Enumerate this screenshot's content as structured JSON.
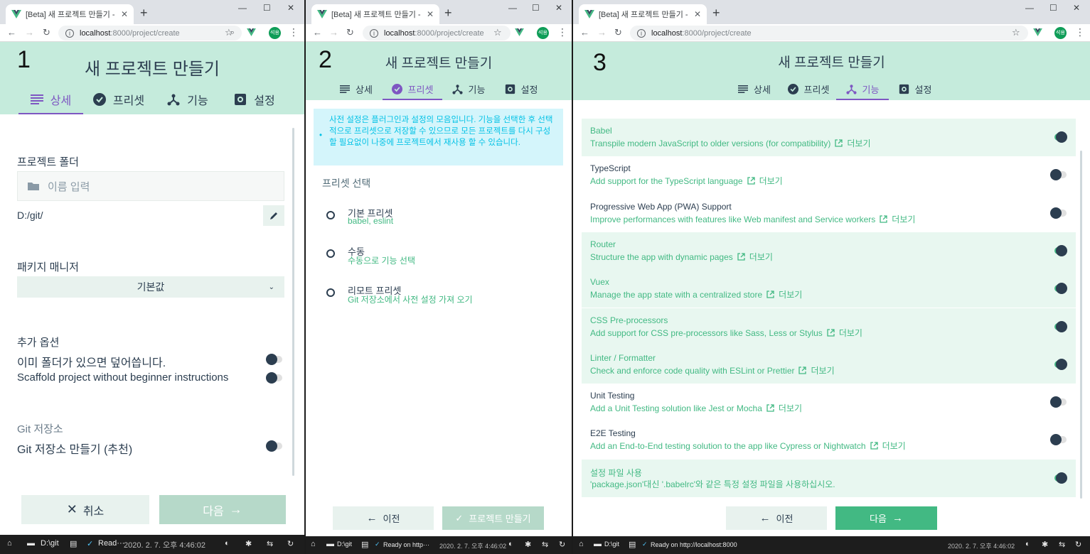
{
  "colors": {
    "accent": "#42b983",
    "purple": "#7e57c2",
    "header_bg": "#c5ebdc",
    "text": "#2c3e50",
    "info_blue": "#03c2e6"
  },
  "browser": {
    "tab_title": "[Beta] 새 프로젝트 만들기 - Vue",
    "url_prefix": "localhost",
    "url_rest": ":8000/project/create",
    "avatar": "석용"
  },
  "page": {
    "title": "새 프로젝트 만들기",
    "tabs": [
      {
        "label": "상세",
        "icon": "list-icon"
      },
      {
        "label": "프리셋",
        "icon": "check-circle-icon"
      },
      {
        "label": "기능",
        "icon": "fork-icon"
      },
      {
        "label": "설정",
        "icon": "gear-icon"
      }
    ]
  },
  "panel1": {
    "step": "1",
    "folder_label": "프로젝트 폴더",
    "folder_placeholder": "이름 입력",
    "path": "D:/git/",
    "pm_label": "패키지 매니저",
    "pm_value": "기본값",
    "options_label": "추가 옵션",
    "opt_overwrite": "이미 폴더가 있으면 덮어씁니다.",
    "opt_scaffold": "Scaffold project without beginner instructions",
    "git_label": "Git 저장소",
    "git_init": "Git 저장소 만들기 (추천)",
    "cancel": "취소",
    "next": "다음"
  },
  "panel2": {
    "step": "2",
    "info": "사전 설정은 플러그인과 설정의 모음입니다. 기능을 선택한 후 선택적으로 프리셋으로 저장할 수 있으므로 모든 프로젝트를 다시 구성 할 필요없이 나중에 프로젝트에서 재사용 할 수 있습니다.",
    "select_label": "프리셋 선택",
    "presets": [
      {
        "name": "기본 프리셋",
        "desc": "babel, eslint"
      },
      {
        "name": "수동",
        "desc": "수동으로 기능 선택"
      },
      {
        "name": "리모트 프리셋",
        "desc": "Git 저장소에서 사전 설정 가져 오기"
      }
    ],
    "prev": "이전",
    "create": "프로젝트 만들기"
  },
  "panel3": {
    "step": "3",
    "more": "더보기",
    "features": [
      {
        "name": "Babel",
        "desc": "Transpile modern JavaScript to older versions (for compatibility)",
        "on": true,
        "more": true
      },
      {
        "name": "TypeScript",
        "desc": "Add support for the TypeScript language",
        "on": false,
        "more": true
      },
      {
        "name": "Progressive Web App (PWA) Support",
        "desc": "Improve performances with features like Web manifest and Service workers",
        "on": false,
        "more": true
      },
      {
        "name": "Router",
        "desc": "Structure the app with dynamic pages",
        "on": true,
        "more": true
      },
      {
        "name": "Vuex",
        "desc": "Manage the app state with a centralized store",
        "on": true,
        "more": true
      },
      {
        "name": "CSS Pre-processors",
        "desc": "Add support for CSS pre-processors like Sass, Less or Stylus",
        "on": true,
        "more": true
      },
      {
        "name": "Linter / Formatter",
        "desc": "Check and enforce code quality with ESLint or Prettier",
        "on": true,
        "more": true
      },
      {
        "name": "Unit Testing",
        "desc": "Add a Unit Testing solution like Jest or Mocha",
        "on": false,
        "more": true
      },
      {
        "name": "E2E Testing",
        "desc": "Add an End-to-End testing solution to the app like Cypress or Nightwatch",
        "on": false,
        "more": true
      },
      {
        "name": "설정 파일 사용",
        "desc": "'package.json'대신 '.babelrc'와 같은 특정 설정 파일을 사용하십시오.",
        "on": true,
        "more": false
      }
    ],
    "prev": "이전",
    "next": "다음"
  },
  "taskbar": {
    "cwd": "D:\\git",
    "status1": "Read···",
    "status2": "Ready on http···",
    "status3": "Ready on http://localhost:8000",
    "datetime": "2020. 2. 7. 오후 4:46:02"
  }
}
